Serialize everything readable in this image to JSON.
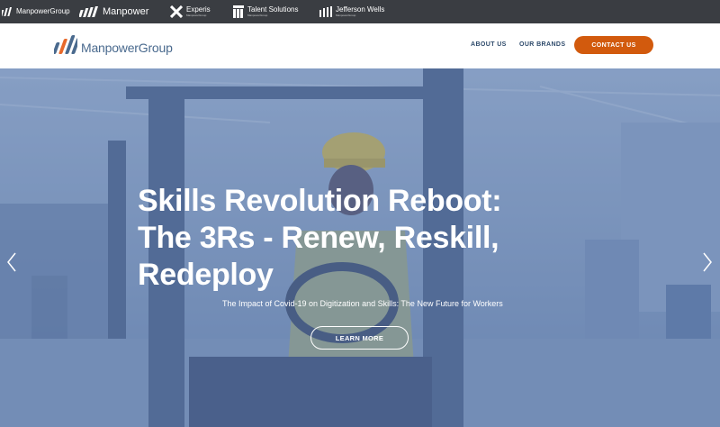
{
  "topbar": {
    "brands": [
      {
        "name": "ManpowerGroup"
      },
      {
        "name": "Manpower"
      },
      {
        "name": "Experis",
        "sub": "ManpowerGroup"
      },
      {
        "name": "Talent Solutions",
        "sub": "ManpowerGroup"
      },
      {
        "name": "Jefferson Wells",
        "sub": "ManpowerGroup"
      }
    ]
  },
  "nav": {
    "logo_text": "ManpowerGroup",
    "about_label": "ABOUT US",
    "brands_label": "OUR BRANDS",
    "contact_label": "CONTACT US"
  },
  "hero": {
    "headline_lines": [
      "Skills Revolution Reboot:",
      "The 3Rs - Renew, Reskill,",
      "Redeploy"
    ],
    "subtitle": "The Impact of Covid-19 on Digitization and Skills: The New Future for Workers",
    "button_label": "LEARN MORE",
    "prev_icon": "chevron-left-icon",
    "next_icon": "chevron-right-icon"
  },
  "colors": {
    "topbar_bg": "#3a3d42",
    "cta_orange": "#d25a0d",
    "hero_overlay": "#7a93b9",
    "nav_text": "#2e4a6b"
  }
}
